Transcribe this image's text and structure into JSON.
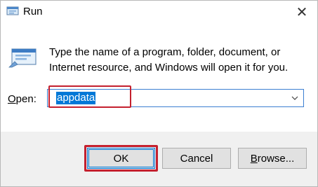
{
  "window": {
    "title": "Run",
    "close_glyph": "✕"
  },
  "content": {
    "description": "Type the name of a program, folder, document, or Internet resource, and Windows will open it for you.",
    "open_label_accel": "O",
    "open_label_rest": "pen:",
    "input_value": "appdata"
  },
  "buttons": {
    "ok": "OK",
    "cancel": "Cancel",
    "browse_accel": "B",
    "browse_rest": "rowse..."
  },
  "colors": {
    "highlight_annotation": "#c4202e",
    "selection": "#0078d7"
  },
  "icons": {
    "title": "run-app-icon",
    "content": "run-app-icon",
    "dropdown": "chevron-down-icon",
    "close": "close-icon"
  }
}
